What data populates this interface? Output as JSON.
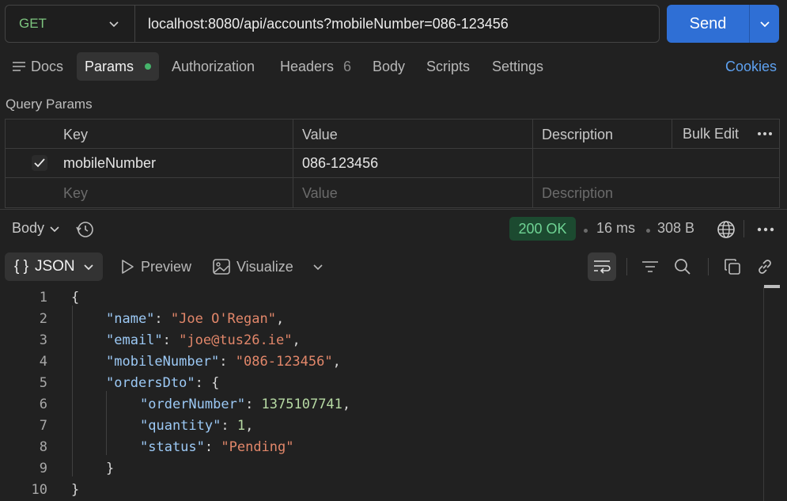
{
  "request": {
    "method": "GET",
    "url": "localhost:8080/api/accounts?mobileNumber=086-123456",
    "send_label": "Send"
  },
  "tabs": {
    "docs": "Docs",
    "params": "Params",
    "authorization": "Authorization",
    "headers": "Headers",
    "headers_count": "6",
    "body": "Body",
    "scripts": "Scripts",
    "settings": "Settings",
    "cookies": "Cookies"
  },
  "query_params": {
    "title": "Query Params",
    "headers": {
      "key": "Key",
      "value": "Value",
      "description": "Description",
      "bulk_edit": "Bulk Edit"
    },
    "rows": [
      {
        "key": "mobileNumber",
        "value": "086-123456",
        "description": ""
      }
    ],
    "placeholders": {
      "key": "Key",
      "value": "Value",
      "description": "Description"
    }
  },
  "response": {
    "body_label": "Body",
    "status": "200 OK",
    "time": "16 ms",
    "size": "308 B",
    "view": {
      "json": "JSON",
      "preview": "Preview",
      "visualize": "Visualize"
    }
  },
  "code": {
    "line_numbers": [
      "1",
      "2",
      "3",
      "4",
      "5",
      "6",
      "7",
      "8",
      "9",
      "10"
    ],
    "name_key": "\"name\"",
    "name_val": "\"Joe O'Regan\"",
    "email_key": "\"email\"",
    "email_val": "\"joe@tus26.ie\"",
    "mobile_key": "\"mobileNumber\"",
    "mobile_val": "\"086-123456\"",
    "orders_key": "\"ordersDto\"",
    "order_number_key": "\"orderNumber\"",
    "order_number_val": "1375107741",
    "quantity_key": "\"quantity\"",
    "quantity_val": "1",
    "status_key": "\"status\"",
    "status_val": "\"Pending\""
  }
}
